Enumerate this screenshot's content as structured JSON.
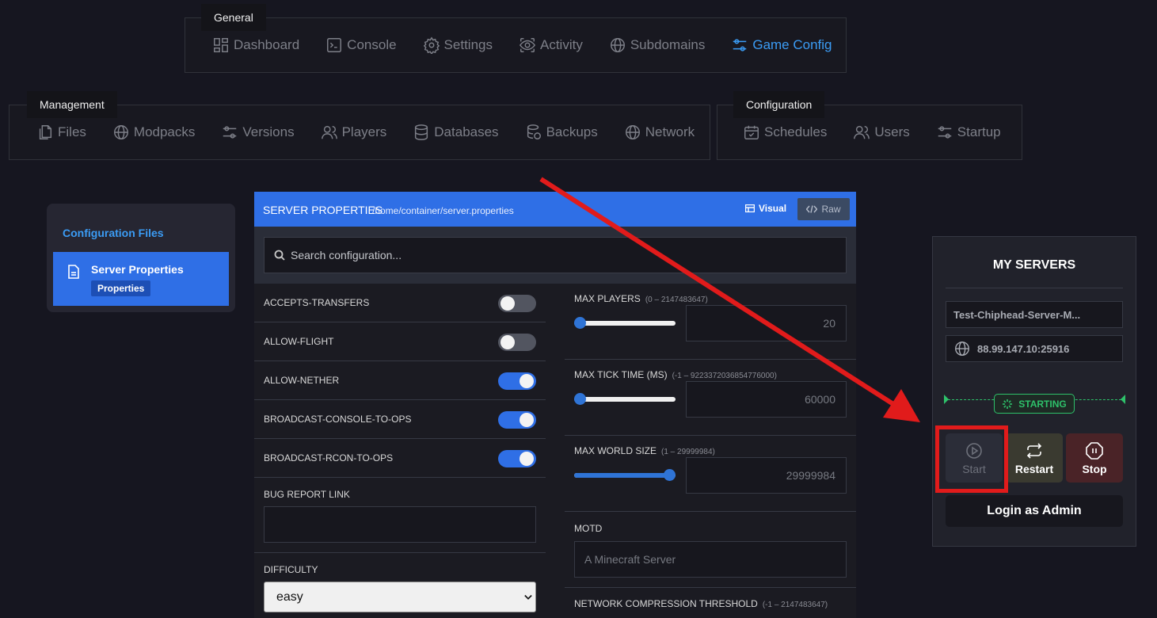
{
  "nav": {
    "general": {
      "title": "General",
      "items": [
        {
          "label": "Dashboard",
          "icon": "dashboard-icon"
        },
        {
          "label": "Console",
          "icon": "console-icon"
        },
        {
          "label": "Settings",
          "icon": "gear-icon"
        },
        {
          "label": "Activity",
          "icon": "eye-icon"
        },
        {
          "label": "Subdomains",
          "icon": "globe-icon"
        },
        {
          "label": "Game Config",
          "icon": "sliders-icon",
          "active": true
        }
      ]
    },
    "management": {
      "title": "Management",
      "items": [
        {
          "label": "Files",
          "icon": "files-icon"
        },
        {
          "label": "Modpacks",
          "icon": "globe-icon"
        },
        {
          "label": "Versions",
          "icon": "sliders-icon"
        },
        {
          "label": "Players",
          "icon": "users-icon"
        },
        {
          "label": "Databases",
          "icon": "database-icon"
        },
        {
          "label": "Backups",
          "icon": "backup-icon"
        },
        {
          "label": "Network",
          "icon": "globe-icon"
        }
      ]
    },
    "configuration": {
      "title": "Configuration",
      "items": [
        {
          "label": "Schedules",
          "icon": "calendar-icon"
        },
        {
          "label": "Users",
          "icon": "users-icon"
        },
        {
          "label": "Startup",
          "icon": "sliders-icon"
        }
      ]
    }
  },
  "config_files": {
    "title": "Configuration Files",
    "file": {
      "name": "Server Properties",
      "badge": "Properties"
    }
  },
  "editor": {
    "title": "SERVER PROPERTIES",
    "path": "/home/container/server.properties",
    "tab_visual": "Visual",
    "tab_raw": "Raw",
    "search_placeholder": "Search configuration...",
    "toggles": [
      {
        "label": "ACCEPTS-TRANSFERS",
        "on": false
      },
      {
        "label": "ALLOW-FLIGHT",
        "on": false
      },
      {
        "label": "ALLOW-NETHER",
        "on": true
      },
      {
        "label": "BROADCAST-CONSOLE-TO-OPS",
        "on": true
      },
      {
        "label": "BROADCAST-RCON-TO-OPS",
        "on": true
      }
    ],
    "bug_report": {
      "label": "BUG REPORT LINK",
      "value": ""
    },
    "difficulty": {
      "label": "DIFFICULTY",
      "value": "easy"
    },
    "numeric": [
      {
        "label": "MAX PLAYERS",
        "range": "(0 – 2147483647)",
        "value": "20",
        "fraction": 0.0
      },
      {
        "label": "MAX TICK TIME (MS)",
        "range": "(-1 – 9223372036854776000)",
        "value": "60000",
        "fraction": 0.0
      },
      {
        "label": "MAX WORLD SIZE",
        "range": "(1 – 29999984)",
        "value": "29999984",
        "fraction": 1.0
      }
    ],
    "motd": {
      "label": "MOTD",
      "value": "A Minecraft Server"
    },
    "network_compression": {
      "label": "NETWORK COMPRESSION THRESHOLD",
      "range": "(-1 – 2147483647)"
    }
  },
  "servers": {
    "title": "MY SERVERS",
    "server_name": "Test-Chiphead-Server-M...",
    "address": "88.99.147.10:25916",
    "status": "STARTING",
    "start": "Start",
    "restart": "Restart",
    "stop": "Stop",
    "login": "Login as Admin"
  },
  "colors": {
    "accent": "#2f6fe6",
    "active_nav": "#3b9cf5",
    "status_green": "#2ec16a",
    "annotation_red": "#e11b1b"
  }
}
